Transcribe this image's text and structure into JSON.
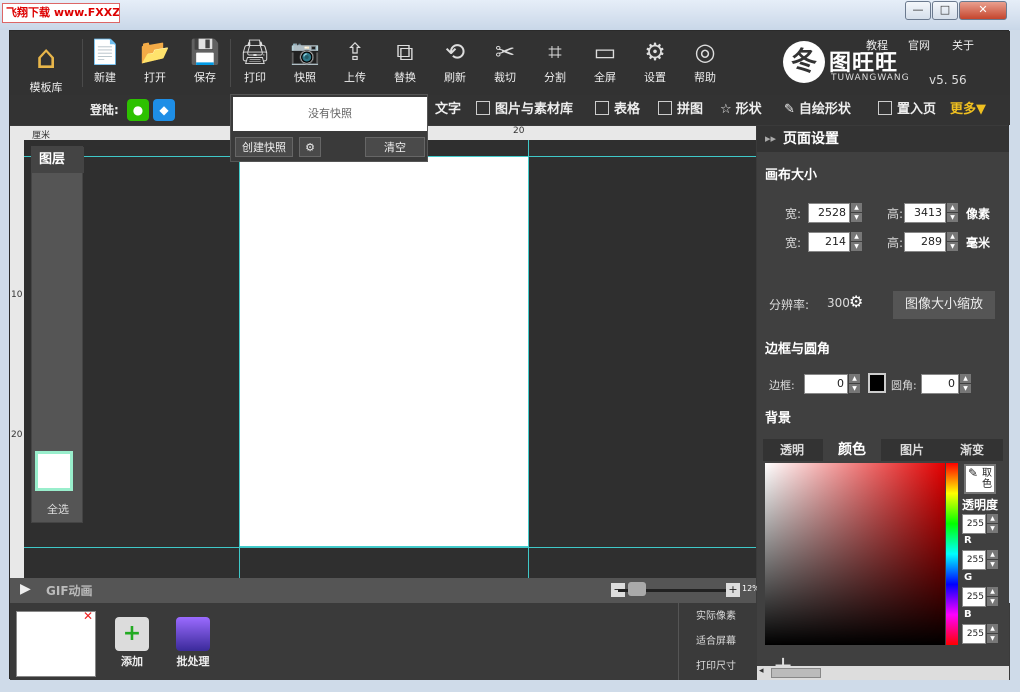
{
  "watermark": "飞翔下载 www.FXXZ.com",
  "window": {
    "minimize": "—",
    "maximize": "□",
    "close": "✕"
  },
  "toolbar": {
    "home": "模板库",
    "items": [
      {
        "label": "新建",
        "icon": "📄"
      },
      {
        "label": "打开",
        "icon": "📂"
      },
      {
        "label": "保存",
        "icon": "💾"
      },
      {
        "label": "打印",
        "icon": "🖨"
      },
      {
        "label": "快照",
        "icon": "📷"
      },
      {
        "label": "上传",
        "icon": "⇪"
      },
      {
        "label": "替换",
        "icon": "⧉"
      },
      {
        "label": "刷新",
        "icon": "⟲"
      },
      {
        "label": "裁切",
        "icon": "✂"
      },
      {
        "label": "分割",
        "icon": "⌗"
      },
      {
        "label": "全屏",
        "icon": "▭"
      },
      {
        "label": "设置",
        "icon": "⚙"
      },
      {
        "label": "帮助",
        "icon": "◎"
      }
    ],
    "login": "登陆:",
    "links": [
      "教程",
      "官网",
      "关于"
    ],
    "brand_name": "图旺旺",
    "brand_en": "TUWANGWANG",
    "version": "v5. 56"
  },
  "secondary": {
    "items": [
      "文字",
      "图片与素材库",
      "表格",
      "拼图",
      "形状",
      "自绘形状",
      "置入页",
      "更多▼"
    ]
  },
  "snapshot": {
    "empty": "没有快照",
    "create": "创建快照",
    "clear": "清空"
  },
  "ruler": {
    "unit": "厘米",
    "top_mark": "20",
    "left_marks": [
      "10",
      "20"
    ]
  },
  "layers": {
    "title": "图层",
    "select_all": "全选"
  },
  "gif": {
    "label": "GIF动画",
    "zoom": "12%"
  },
  "bottom": {
    "add": "添加",
    "batch": "批处理",
    "sizes": [
      "实际像素",
      "适合屏幕",
      "打印尺寸"
    ]
  },
  "panel": {
    "title": "页面设置",
    "canvas_size": "画布大小",
    "width_label": "宽:",
    "height_label": "高:",
    "width_px": "2528",
    "height_px": "3413",
    "unit_px": "像素",
    "width_mm": "214",
    "height_mm": "289",
    "unit_mm": "毫米",
    "dpi_label": "分辨率:",
    "dpi": "300",
    "scale_button": "图像大小缩放",
    "border_title": "边框与圆角",
    "border_label": "边框:",
    "border_value": "0",
    "radius_label": "圆角:",
    "radius_value": "0",
    "bg_title": "背景",
    "bg_tabs": [
      "透明",
      "颜色",
      "图片",
      "渐变"
    ],
    "eyedropper": "取色",
    "opacity_label": "透明度",
    "opacity": "255",
    "r_label": "R",
    "r": "255",
    "g_label": "G",
    "g": "255",
    "b_label": "B",
    "b": "255",
    "add": "+"
  }
}
